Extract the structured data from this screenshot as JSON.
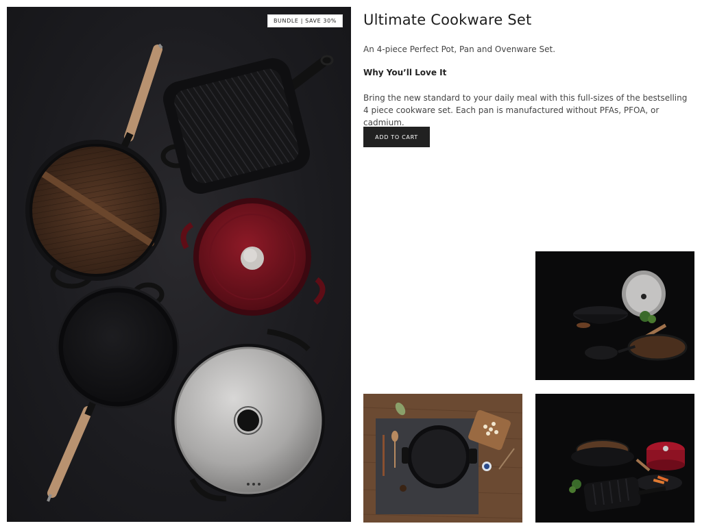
{
  "product": {
    "badge": "BUNDLE | SAVE 30%",
    "title": "Ultimate Cookware Set",
    "subtitle": "An 4-piece Perfect Pot, Pan and Ovenware Set.",
    "why_heading": "Why You’ll Love It",
    "description": "Bring the new standard to your daily meal with this full-sizes of the bestselling 4 piece cookware set. Each pan is manufactured without PFAs, PFOA, or cadmium.",
    "add_to_cart": "ADD TO CART"
  },
  "colors": {
    "button_bg": "#212121",
    "hero_bg": "#1c1c20",
    "dutch_oven": "#7a1420"
  }
}
